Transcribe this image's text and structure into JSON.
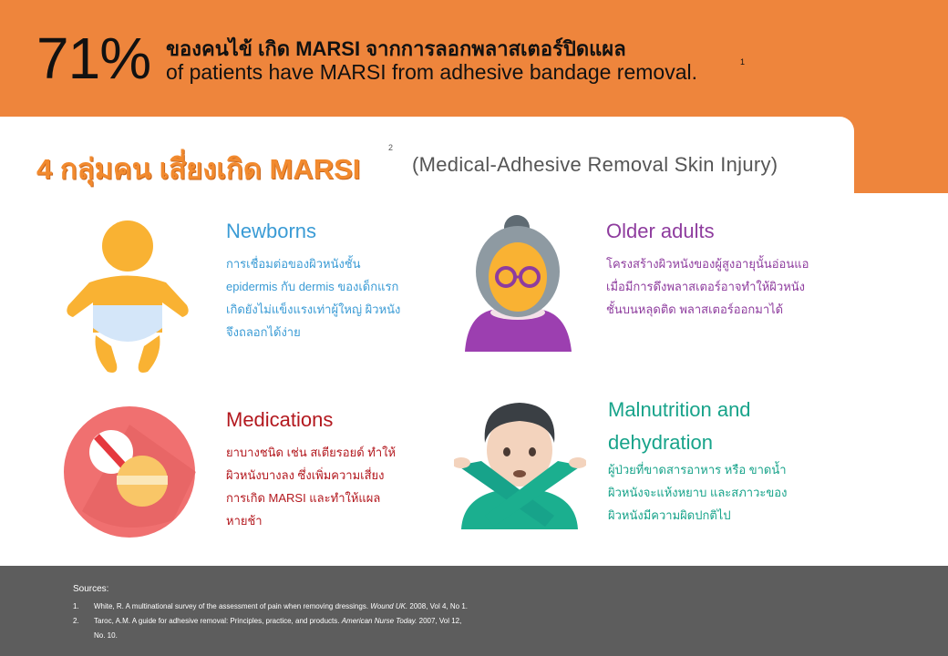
{
  "header": {
    "stat": "71%",
    "headline_th": "ของคนไข้ เกิด MARSI จากการลอกพลาสเตอร์ปิดแผล",
    "headline_en": "of patients have MARSI from adhesive bandage removal.",
    "footnote_ref": "1",
    "accent_color": "#EE853C"
  },
  "section": {
    "title": "4 กลุ่มคน เสี่ยงเกิด MARSI",
    "footnote_ref": "2",
    "subtitle": "(Medical-Adhesive Removal Skin Injury)"
  },
  "groups": [
    {
      "title": "Newborns",
      "lines": [
        "การเชื่อมต่อของผิวหนังชั้น",
        "epidermis กับ dermis ของเด็กแรก",
        "เกิดยังไม่แข็งแรงเท่าผู้ใหญ่ ผิวหนัง",
        "จึงถลอกได้ง่าย"
      ],
      "icon": "baby-icon",
      "color": "#3A9BD5"
    },
    {
      "title": "Older adults",
      "lines": [
        "โครงสร้างผิวหนังของผู้สูงอายุนั้นอ่อนแอ",
        "เมื่อมีการดึงพลาสเตอร์อาจทำให้ผิวหนัง",
        "ชั้นบนหลุดติด พลาสเตอร์ออกมาได้"
      ],
      "icon": "elderly-woman-icon",
      "color": "#8E3C9E"
    },
    {
      "title": "Medications",
      "lines": [
        "ยาบางชนิด เช่น สเตียรอยด์ ทำให้",
        "ผิวหนังบางลง ซึ่งเพิ่มความเสี่ยง",
        "การเกิด MARSI และทำให้แผล",
        "หายช้า"
      ],
      "icon": "pills-icon",
      "color": "#B3181E"
    },
    {
      "title_lines": [
        "Malnutrition  and",
        "dehydration"
      ],
      "lines": [
        "ผู้ป่วยที่ขาดสารอาหาร หรือ ขาดน้ำ",
        "ผิวหนังจะแห้งหยาบ และสภาวะของ",
        "ผิวหนังมีความผิดปกติไป"
      ],
      "icon": "person-gesturing-no-icon",
      "color": "#17A38A"
    }
  ],
  "footer": {
    "title": "Sources:",
    "sources": [
      {
        "num": "1.",
        "text": "White, R. A multinational survey of the assessment of pain when removing dressings. ",
        "journal": "Wound UK.",
        "rest": " 2008, Vol 4, No 1."
      },
      {
        "num": "2.",
        "text": "Taroc, A.M.  A guide for adhesive removal: Principles, practice, and products. ",
        "journal": "American Nurse Today.",
        "rest": " 2007, Vol 12,",
        "line2": "No. 10."
      }
    ]
  }
}
